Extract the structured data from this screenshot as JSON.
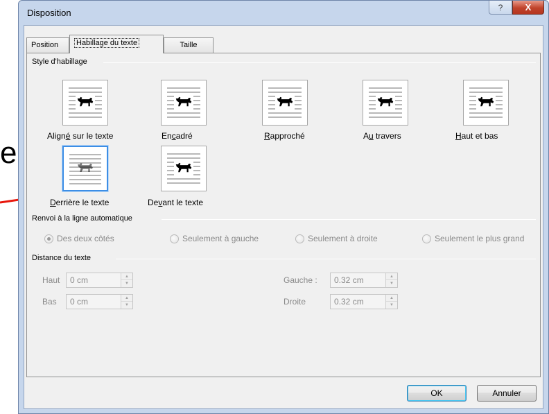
{
  "background_fragment": "e",
  "window": {
    "title": "Disposition",
    "help_label": "?",
    "close_label": "X"
  },
  "tabs": [
    {
      "label": "Position",
      "active": false
    },
    {
      "label": "Habillage du texte",
      "active": true
    },
    {
      "label": "Taille",
      "active": false
    }
  ],
  "wrap_style": {
    "group_label": "Style d'habillage",
    "items": [
      {
        "id": "inline",
        "label_before": "Align",
        "mnemonic": "é",
        "label_after": " sur le texte",
        "selected": false,
        "icon": "dog-inline-icon"
      },
      {
        "id": "square",
        "label_before": "En",
        "mnemonic": "c",
        "label_after": "adré",
        "selected": false,
        "icon": "dog-square-icon"
      },
      {
        "id": "tight",
        "label_before": "",
        "mnemonic": "R",
        "label_after": "approché",
        "selected": false,
        "icon": "dog-tight-icon"
      },
      {
        "id": "through",
        "label_before": "A",
        "mnemonic": "u",
        "label_after": " travers",
        "selected": false,
        "icon": "dog-through-icon"
      },
      {
        "id": "topbottom",
        "label_before": "",
        "mnemonic": "H",
        "label_after": "aut et bas",
        "selected": false,
        "icon": "dog-topbottom-icon"
      },
      {
        "id": "behind",
        "label_before": "",
        "mnemonic": "D",
        "label_after": "errière le texte",
        "selected": true,
        "icon": "dog-behind-icon"
      },
      {
        "id": "front",
        "label_before": "De",
        "mnemonic": "v",
        "label_after": "ant le texte",
        "selected": false,
        "icon": "dog-front-icon"
      }
    ]
  },
  "wrap_text": {
    "group_label": "Renvoi à la ligne automatique",
    "options": [
      {
        "label": "Des deux côtés",
        "checked": true
      },
      {
        "label": "Seulement à gauche",
        "checked": false
      },
      {
        "label": "Seulement à droite",
        "checked": false
      },
      {
        "label": "Seulement le plus grand",
        "checked": false
      }
    ]
  },
  "distance": {
    "group_label": "Distance du texte",
    "top": {
      "label": "Haut",
      "value": "0 cm"
    },
    "bottom": {
      "label": "Bas",
      "value": "0 cm"
    },
    "left": {
      "label": "Gauche :",
      "value": "0.32 cm"
    },
    "right": {
      "label": "Droite",
      "value": "0.32 cm"
    }
  },
  "buttons": {
    "ok": "OK",
    "cancel": "Annuler"
  },
  "colors": {
    "annotation_arrow": "#e8170c",
    "selection_border": "#3d8ee5"
  }
}
